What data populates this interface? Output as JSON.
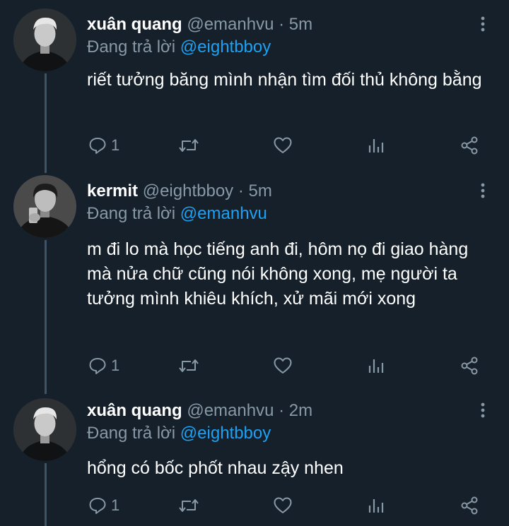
{
  "tweets": [
    {
      "name": "xuân quang",
      "handle": "@emanhvu",
      "separator": "·",
      "time": "5m",
      "reply_prefix": "Đang trả lời",
      "reply_to": "@eightbboy",
      "text": "riết tưởng băng mình nhận tìm đối thủ không bằng",
      "reply_count": "1",
      "avatar_icon": "avatar-photo"
    },
    {
      "name": "kermit",
      "handle": "@eightbboy",
      "separator": "·",
      "time": "5m",
      "reply_prefix": "Đang trả lời",
      "reply_to": "@emanhvu",
      "text": "m đi lo mà học tiếng anh đi, hôm nọ đi giao hàng mà nửa chữ cũng nói không xong, mẹ người ta tưởng mình khiêu khích, xử mãi mới xong",
      "reply_count": "1",
      "avatar_icon": "avatar-photo"
    },
    {
      "name": "xuân quang",
      "handle": "@emanhvu",
      "separator": "·",
      "time": "2m",
      "reply_prefix": "Đang trả lời",
      "reply_to": "@eightbboy",
      "text": "hổng có bốc phốt nhau zậy nhen",
      "reply_count": "1",
      "avatar_icon": "avatar-photo"
    }
  ],
  "colors": {
    "background": "#15202b",
    "text": "#ffffff",
    "muted": "#8899a6",
    "accent": "#1da1f2",
    "thread_line": "#3d5466"
  },
  "icons": [
    "more-vertical-icon",
    "reply-icon",
    "retweet-icon",
    "like-icon",
    "analytics-icon",
    "share-icon"
  ]
}
